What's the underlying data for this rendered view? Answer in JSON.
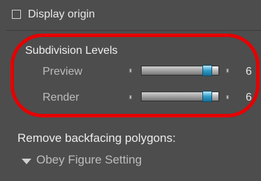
{
  "display_origin": {
    "label": "Display origin",
    "checked": false
  },
  "subdivision": {
    "title": "Subdivision Levels",
    "preview": {
      "label": "Preview",
      "value": "6",
      "fraction": 0.86
    },
    "render": {
      "label": "Render",
      "value": "6",
      "fraction": 0.86
    }
  },
  "backfacing": {
    "label": "Remove backfacing polygons:",
    "selected": "Obey Figure Setting"
  },
  "colors": {
    "panel_bg": "#4d4d4d",
    "highlight": "#e60000",
    "thumb": "#2e9cc8"
  }
}
